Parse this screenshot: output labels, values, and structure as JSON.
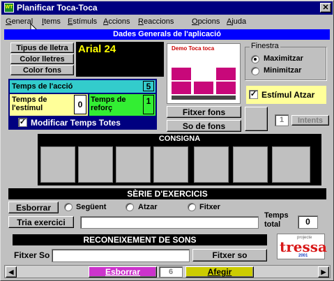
{
  "window": {
    "title": "Planificar Toca-Toca",
    "close_glyph": "✕",
    "app_icon": "app-icon",
    "app_icon_text": "WT"
  },
  "menu": [
    {
      "label": "General",
      "underline": "G",
      "rest": "eneral"
    },
    {
      "label": "Items",
      "underline": "I",
      "rest": "tems"
    },
    {
      "label": "Estímuls",
      "underline": "E",
      "rest": "stímuls"
    },
    {
      "label": "Accions",
      "underline": "A",
      "rest": "ccions"
    },
    {
      "label": "Reaccions",
      "underline": "R",
      "rest": "eaccions"
    },
    {
      "label": "Opcions",
      "underline": "O",
      "rest": "pcions"
    },
    {
      "label": "Ajuda",
      "underline": "A",
      "rest": "juda"
    }
  ],
  "general": {
    "header": "Dades Generals de l'aplicació",
    "btn_tipus": "Tipus de lletra",
    "btn_color_lletres": "Color lletres",
    "btn_color_fons": "Color fons",
    "font_preview": "Arial 24",
    "preview_title": "Demo Toca toca"
  },
  "finestra": {
    "legend": "Finestra",
    "maximitzar": "Maximitzar",
    "minimitzar": "Minimitzar",
    "selected": "Maximitzar"
  },
  "estimul_atzar": {
    "label": "Estímul Atzar",
    "checked": true
  },
  "temps": {
    "accio_label": "Temps de l'acció",
    "accio_value": "5",
    "estimul_label": "Temps de l'estímul",
    "estimul_value": "0",
    "reforc_label": "Temps de reforç",
    "reforc_value": "1",
    "modificar_label": "Modificar Temps Totes",
    "modificar_checked": true
  },
  "fons": {
    "fitxer_fons": "Fitxer fons",
    "so_de_fons": "So de fons",
    "intents_value": "1",
    "intents_label": "Intents"
  },
  "consigna": {
    "header": "CONSIGNA",
    "cells": 7
  },
  "serie": {
    "header": "SÈRIE D'EXERCICIS",
    "esborrar": "Esborrar",
    "seguent": "Següent",
    "atzar": "Atzar",
    "fitxer": "Fitxer",
    "tria_exercici": "Tria exercici",
    "exercici_value": "",
    "temps_total_label_1": "Temps",
    "temps_total_label_2": "total",
    "temps_total_value": "0"
  },
  "reconeixement": {
    "header": "RECONEIXEMENT DE SONS",
    "fitxer_so_label": "Fitxer So",
    "fitxer_so_value": "",
    "fitxer_so_button": "Fitxer so"
  },
  "logo": {
    "top": "projecte",
    "main": "tressa",
    "year": "2001"
  },
  "bottom": {
    "esborrar": "Esborrar",
    "counter": "6",
    "afegir": "Afegir",
    "esborrar_color": "#cc33cc",
    "afegir_color": "#cccc00"
  }
}
